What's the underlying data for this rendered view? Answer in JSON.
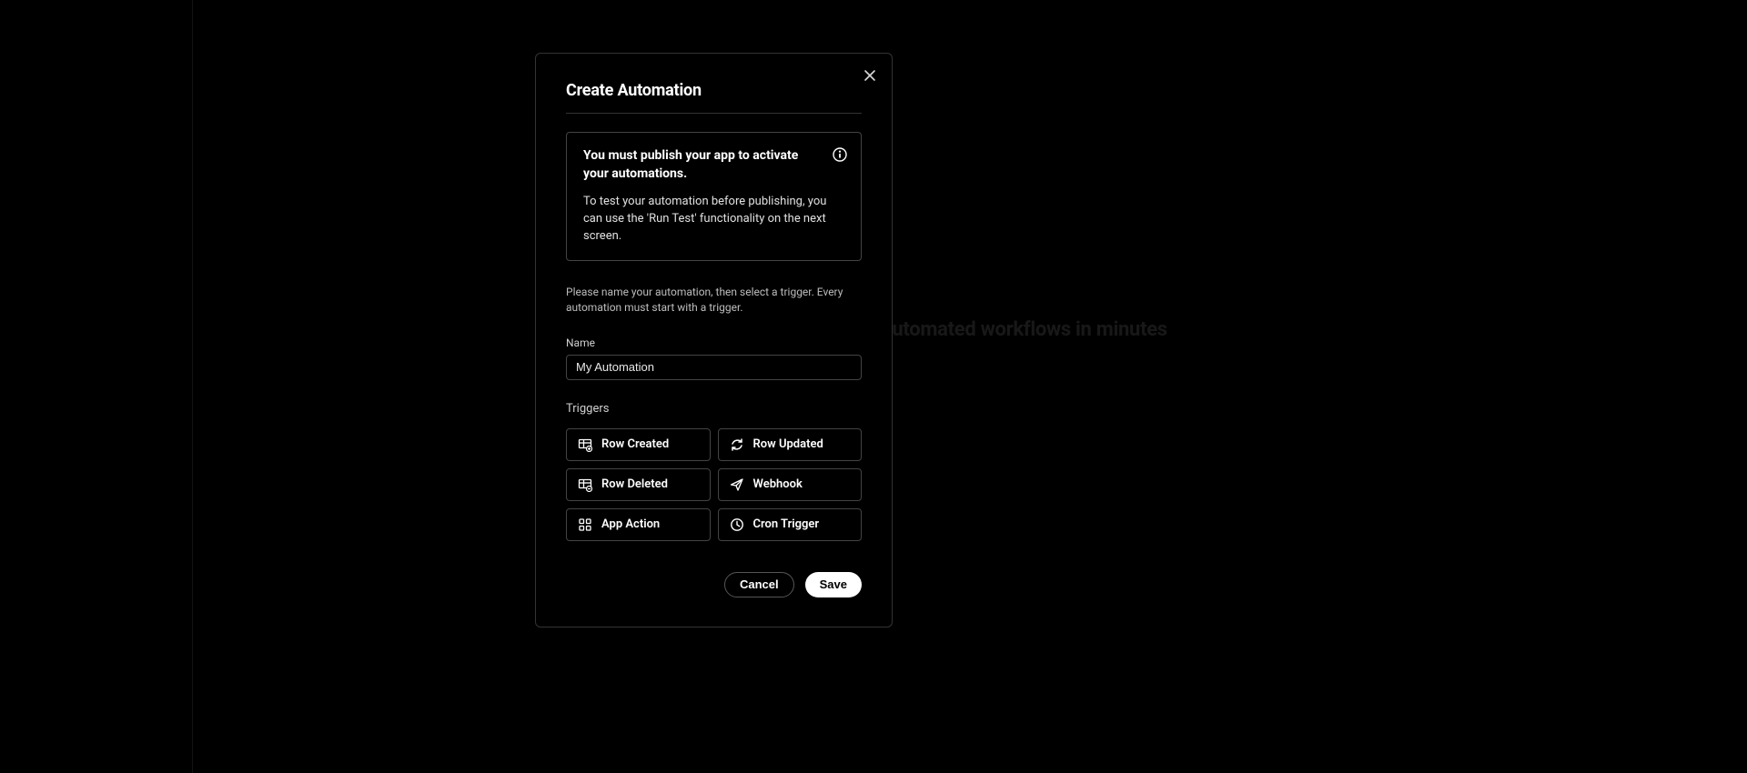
{
  "background": {
    "hint_text": "ith powerful automated workflows in minutes"
  },
  "modal": {
    "title": "Create Automation",
    "info_box": {
      "heading": "You must publish your app to activate your automations.",
      "body": "To test your automation before publishing, you can use the 'Run Test' functionality on the next screen."
    },
    "help_text": "Please name your automation, then select a trigger. Every automation must start with a trigger.",
    "name_field": {
      "label": "Name",
      "value": "My Automation"
    },
    "triggers_label": "Triggers",
    "triggers": [
      {
        "icon": "table-plus-icon",
        "label": "Row Created"
      },
      {
        "icon": "refresh-icon",
        "label": "Row Updated"
      },
      {
        "icon": "table-minus-icon",
        "label": "Row Deleted"
      },
      {
        "icon": "paper-plane-icon",
        "label": "Webhook"
      },
      {
        "icon": "apps-grid-icon",
        "label": "App Action"
      },
      {
        "icon": "clock-icon",
        "label": "Cron Trigger"
      }
    ],
    "footer": {
      "cancel": "Cancel",
      "save": "Save"
    }
  },
  "colors": {
    "modal_border": "#333333",
    "option_border": "#444444"
  }
}
